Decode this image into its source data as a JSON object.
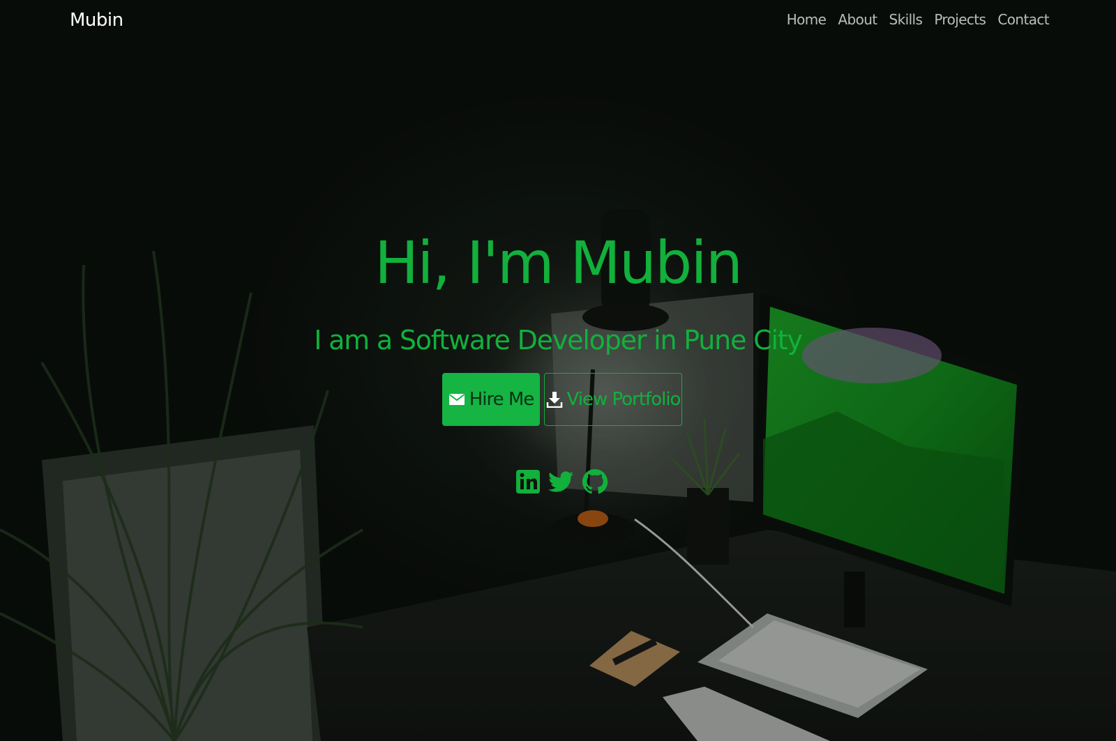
{
  "navbar": {
    "brand": "Mubin",
    "links": [
      {
        "label": "Home"
      },
      {
        "label": "About"
      },
      {
        "label": "Skills"
      },
      {
        "label": "Projects"
      },
      {
        "label": "Contact"
      }
    ]
  },
  "hero": {
    "title": "Hi, I'm Mubin",
    "subtitle": "I am a Software Developer in Pune City",
    "buttons": {
      "hire_label": "Hire Me",
      "hire_icon": "envelope-icon",
      "portfolio_label": "View Portfolio",
      "portfolio_icon": "download-icon"
    },
    "socials": [
      {
        "icon": "linkedin-icon"
      },
      {
        "icon": "twitter-icon"
      },
      {
        "icon": "github-icon"
      }
    ]
  },
  "colors": {
    "accent": "#12b03c",
    "button_fill": "#15b443",
    "nav_text": "#ffffffb8",
    "background": "#0d130e"
  }
}
